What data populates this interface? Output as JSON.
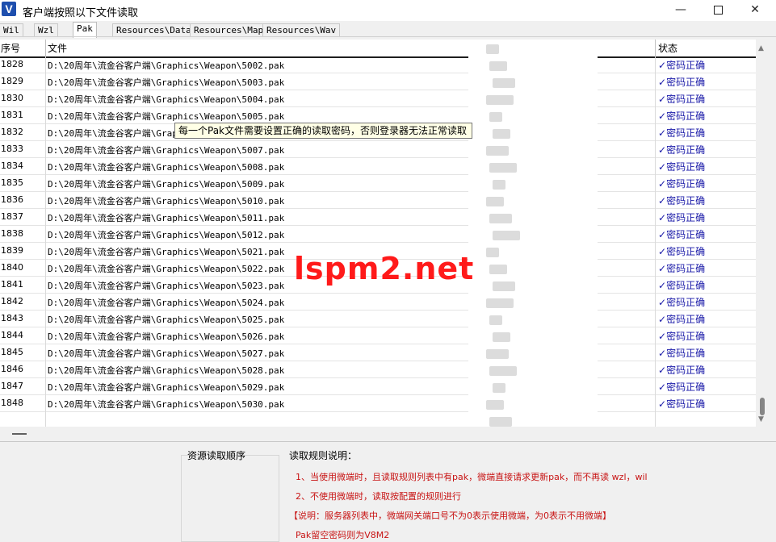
{
  "window": {
    "icon_letter": "V",
    "title": "客户端按照以下文件读取",
    "min": "—",
    "close": "✕"
  },
  "tabs": [
    "Wil",
    "Wzl",
    "Pak",
    "Resources\\Data",
    "Resources\\Map",
    "Resources\\Wav"
  ],
  "active_tab": "Pak",
  "table": {
    "headers": {
      "id": "序号",
      "file": "文件",
      "status": "状态"
    },
    "status_check": "✓",
    "rows": [
      {
        "id": "1828",
        "file": "D:\\20周年\\流金谷客户端\\Graphics\\Weapon\\5002.pak",
        "status": "密码正确"
      },
      {
        "id": "1829",
        "file": "D:\\20周年\\流金谷客户端\\Graphics\\Weapon\\5003.pak",
        "status": "密码正确"
      },
      {
        "id": "1830",
        "file": "D:\\20周年\\流金谷客户端\\Graphics\\Weapon\\5004.pak",
        "status": "密码正确"
      },
      {
        "id": "1831",
        "file": "D:\\20周年\\流金谷客户端\\Graphics\\Weapon\\5005.pak",
        "status": "密码正确"
      },
      {
        "id": "1832",
        "file": "D:\\20周年\\流金谷客户端\\Graphics\\Weapon\\5006.pak",
        "status": "密码正确"
      },
      {
        "id": "1833",
        "file": "D:\\20周年\\流金谷客户端\\Graphics\\Weapon\\5007.pak",
        "status": "密码正确"
      },
      {
        "id": "1834",
        "file": "D:\\20周年\\流金谷客户端\\Graphics\\Weapon\\5008.pak",
        "status": "密码正确"
      },
      {
        "id": "1835",
        "file": "D:\\20周年\\流金谷客户端\\Graphics\\Weapon\\5009.pak",
        "status": "密码正确"
      },
      {
        "id": "1836",
        "file": "D:\\20周年\\流金谷客户端\\Graphics\\Weapon\\5010.pak",
        "status": "密码正确"
      },
      {
        "id": "1837",
        "file": "D:\\20周年\\流金谷客户端\\Graphics\\Weapon\\5011.pak",
        "status": "密码正确"
      },
      {
        "id": "1838",
        "file": "D:\\20周年\\流金谷客户端\\Graphics\\Weapon\\5012.pak",
        "status": "密码正确"
      },
      {
        "id": "1839",
        "file": "D:\\20周年\\流金谷客户端\\Graphics\\Weapon\\5021.pak",
        "status": "密码正确"
      },
      {
        "id": "1840",
        "file": "D:\\20周年\\流金谷客户端\\Graphics\\Weapon\\5022.pak",
        "status": "密码正确"
      },
      {
        "id": "1841",
        "file": "D:\\20周年\\流金谷客户端\\Graphics\\Weapon\\5023.pak",
        "status": "密码正确"
      },
      {
        "id": "1842",
        "file": "D:\\20周年\\流金谷客户端\\Graphics\\Weapon\\5024.pak",
        "status": "密码正确"
      },
      {
        "id": "1843",
        "file": "D:\\20周年\\流金谷客户端\\Graphics\\Weapon\\5025.pak",
        "status": "密码正确"
      },
      {
        "id": "1844",
        "file": "D:\\20周年\\流金谷客户端\\Graphics\\Weapon\\5026.pak",
        "status": "密码正确"
      },
      {
        "id": "1845",
        "file": "D:\\20周年\\流金谷客户端\\Graphics\\Weapon\\5027.pak",
        "status": "密码正确"
      },
      {
        "id": "1846",
        "file": "D:\\20周年\\流金谷客户端\\Graphics\\Weapon\\5028.pak",
        "status": "密码正确"
      },
      {
        "id": "1847",
        "file": "D:\\20周年\\流金谷客户端\\Graphics\\Weapon\\5029.pak",
        "status": "密码正确"
      },
      {
        "id": "1848",
        "file": "D:\\20周年\\流金谷客户端\\Graphics\\Weapon\\5030.pak",
        "status": "密码正确"
      }
    ]
  },
  "tooltip": "每一个Pak文件需要设置正确的读取密码，否则登录器无法正常读取",
  "watermark": "lspm2.net",
  "bottom": {
    "order_label": "资源读取顺序",
    "rules_title": "读取规则说明：",
    "rules": [
      "1、当使用微端时，且读取规则列表中有pak，微端直接请求更新pak，而不再读 wzl，wil",
      "2、不使用微端时，读取按配置的规则进行",
      "【说明：服务器列表中，微端网关端口号不为0表示使用微端，为0表示不用微端】",
      "Pak留空密码则为V8M2"
    ]
  },
  "colors": {
    "status_text": "#1a1aa8",
    "rule_text": "#c81414",
    "watermark": "#ff1a1a",
    "tooltip_bg": "#ffffe6"
  }
}
